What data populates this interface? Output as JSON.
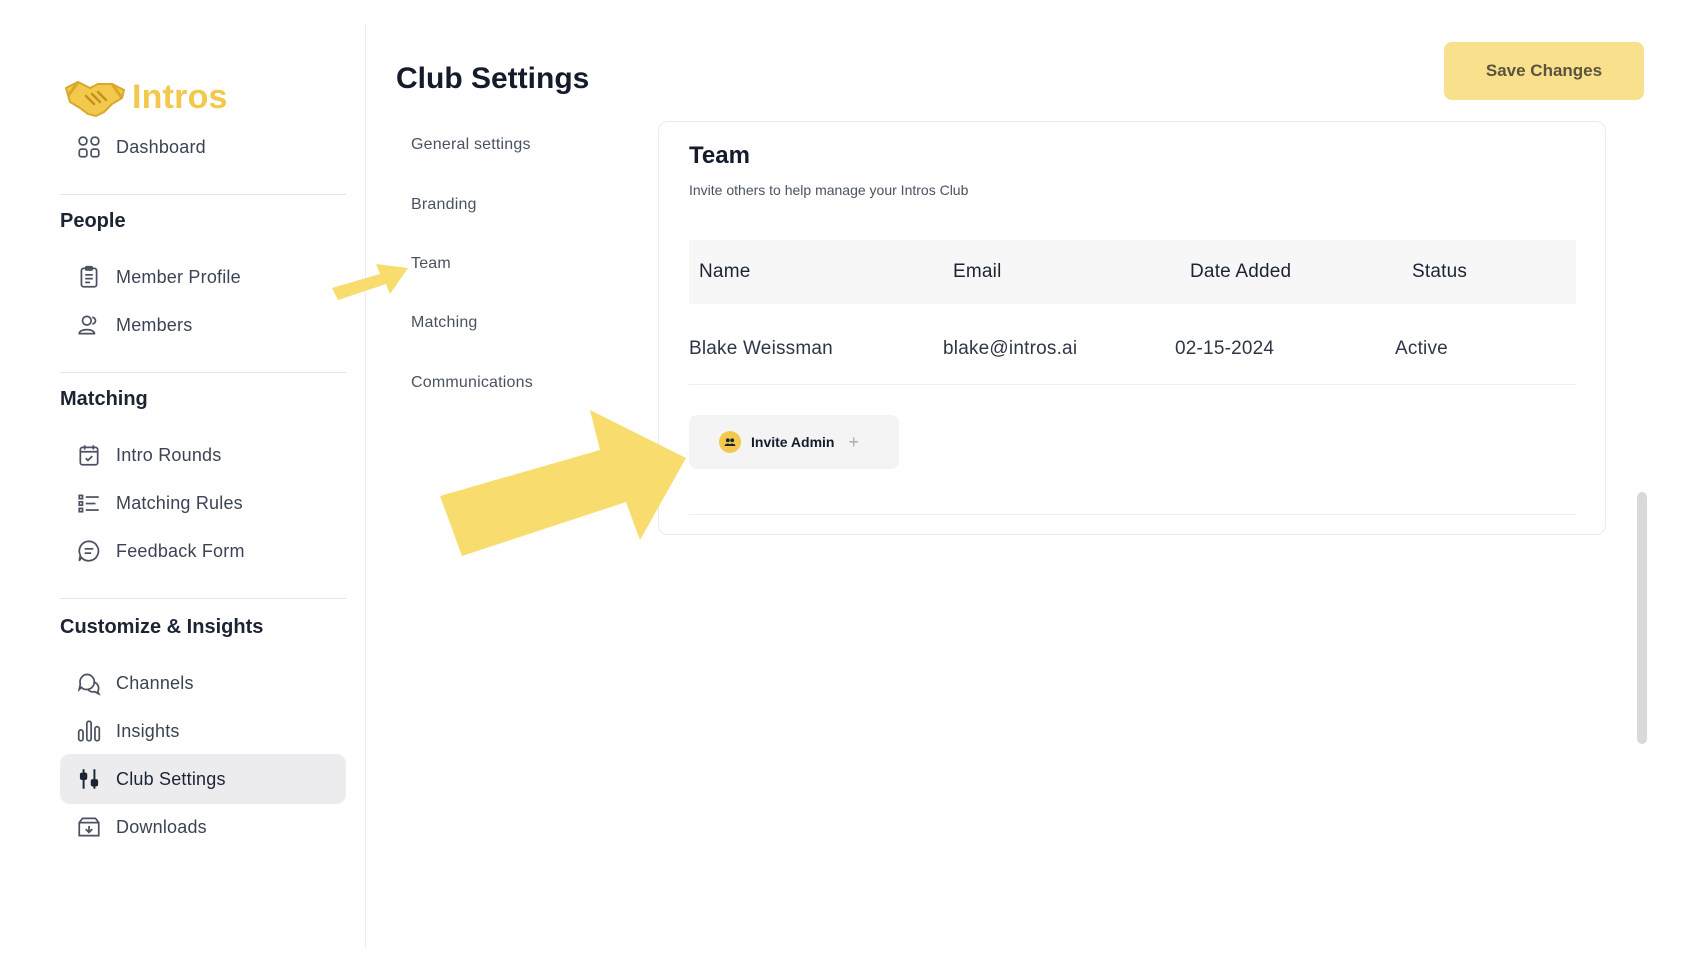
{
  "app": {
    "name": "Intros",
    "brand_color": "#F2C94C"
  },
  "sidebar": {
    "dashboard": {
      "label": "Dashboard",
      "icon": "grid-icon"
    },
    "sections": [
      {
        "title": "People",
        "items": [
          {
            "label": "Member Profile",
            "icon": "clipboard-icon"
          },
          {
            "label": "Members",
            "icon": "users-icon"
          }
        ]
      },
      {
        "title": "Matching",
        "items": [
          {
            "label": "Intro Rounds",
            "icon": "calendar-check-icon"
          },
          {
            "label": "Matching Rules",
            "icon": "list-rules-icon"
          },
          {
            "label": "Feedback Form",
            "icon": "message-square-icon"
          }
        ]
      },
      {
        "title": "Customize & Insights",
        "items": [
          {
            "label": "Channels",
            "icon": "chat-bubbles-icon"
          },
          {
            "label": "Insights",
            "icon": "bar-chart-icon"
          },
          {
            "label": "Club Settings",
            "icon": "sliders-icon",
            "active": true
          },
          {
            "label": "Downloads",
            "icon": "download-box-icon"
          }
        ]
      }
    ]
  },
  "header": {
    "title": "Club Settings",
    "save_label": "Save Changes"
  },
  "settings_nav": [
    "General settings",
    "Branding",
    "Team",
    "Matching",
    "Communications"
  ],
  "team": {
    "title": "Team",
    "subtitle": "Invite others to help manage your Intros Club",
    "columns": [
      "Name",
      "Email",
      "Date Added",
      "Status"
    ],
    "rows": [
      [
        "Blake Weissman",
        "blake@intros.ai",
        "02-15-2024",
        "Active"
      ]
    ],
    "invite_label": "Invite Admin",
    "invite_plus": "+"
  },
  "annotation_color": "#F9DC6E"
}
